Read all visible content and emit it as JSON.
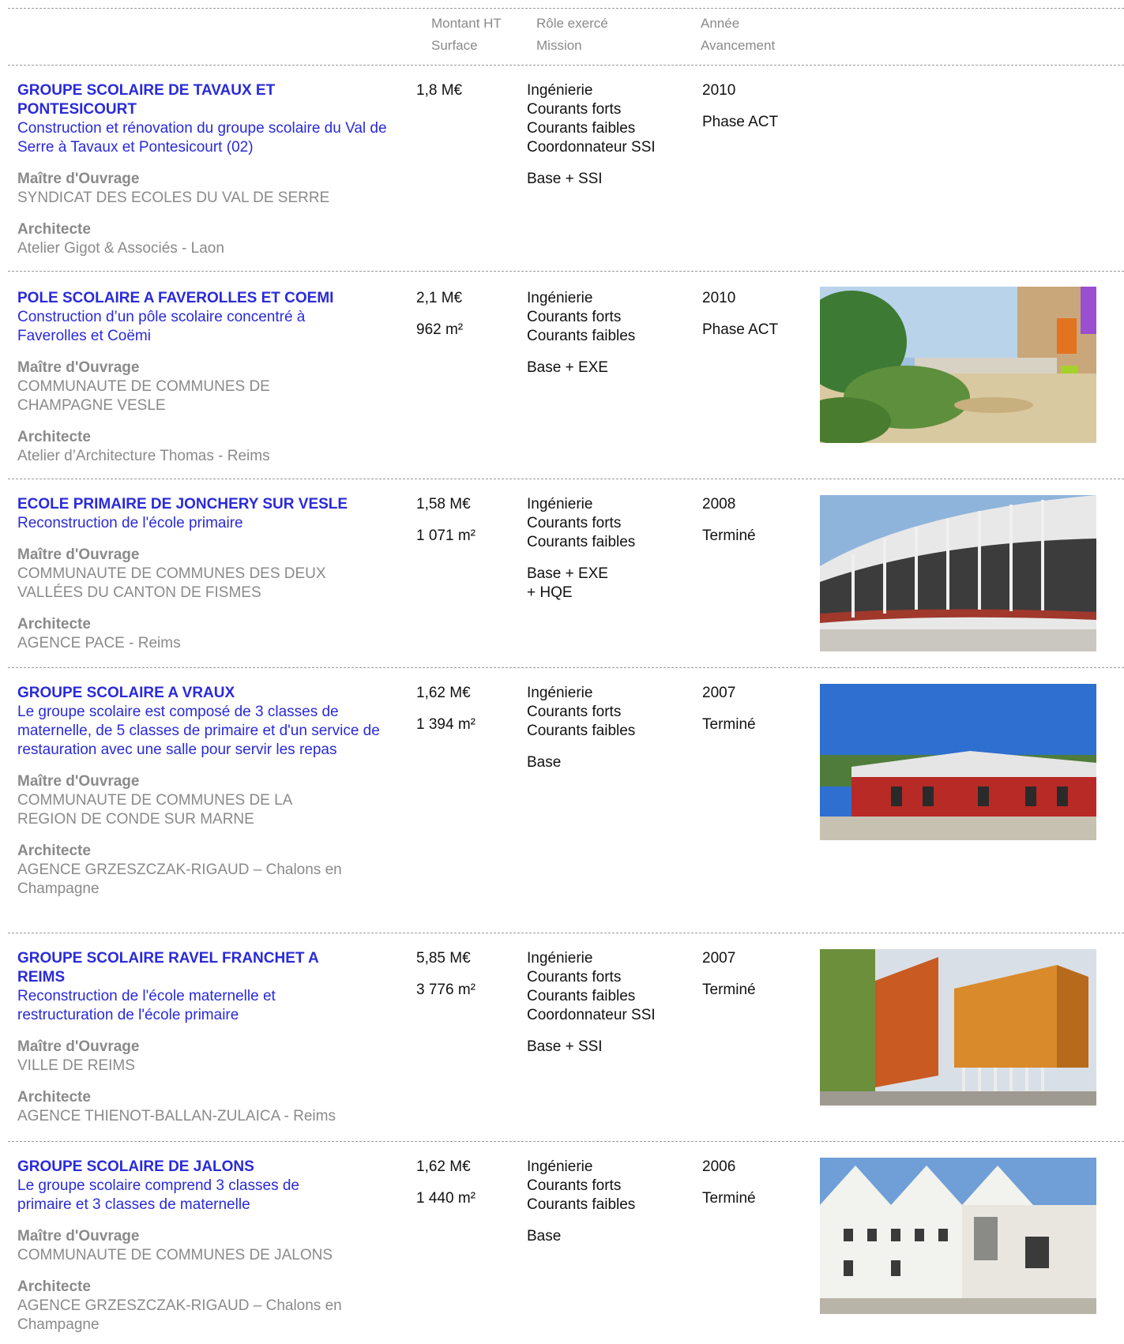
{
  "header": {
    "amount": "Montant HT",
    "surface": "Surface",
    "role": "Rôle exercé",
    "mission": "Mission",
    "year": "Année",
    "progress": "Avancement"
  },
  "labels": {
    "owner": "Maître d'Ouvrage",
    "architect": "Architecte"
  },
  "projects": [
    {
      "title": "GROUPE SCOLAIRE DE TAVAUX ET PONTESICOURT",
      "description": "Construction et rénovation du groupe scolaire du Val de Serre à Tavaux et Pontesicourt (02)",
      "owner": "SYNDICAT DES ECOLES DU VAL DE SERRE",
      "architect": "Atelier Gigot & Associés - Laon",
      "amount": "1,8 M€",
      "surface": "",
      "roles": [
        "Ingénierie",
        "Courants forts",
        "Courants faibles",
        "Coordonnateur SSI"
      ],
      "mission": "Base + SSI",
      "year": "2010",
      "status": "Phase ACT"
    },
    {
      "title": "POLE SCOLAIRE A FAVEROLLES ET COEMI",
      "description": "Construction d’un pôle scolaire concentré à Faverolles et Coëmi",
      "owner": "COMMUNAUTE DE COMMUNES DE CHAMPAGNE VESLE",
      "architect": "Atelier d’Architecture Thomas - Reims",
      "amount": "2,1 M€",
      "surface": "962 m²",
      "roles": [
        "Ingénierie",
        "Courants forts",
        "Courants faibles"
      ],
      "mission": "Base + EXE",
      "year": "2010",
      "status": "Phase ACT"
    },
    {
      "title": "ECOLE PRIMAIRE DE JONCHERY SUR VESLE",
      "description": "Reconstruction de l'école primaire",
      "owner": "COMMUNAUTE DE COMMUNES DES DEUX VALLÉES DU CANTON DE FISMES",
      "architect": "AGENCE PACE - Reims",
      "amount": "1,58 M€",
      "surface": "1 071 m²",
      "roles": [
        "Ingénierie",
        "Courants forts",
        "Courants faibles"
      ],
      "mission": "Base + EXE\n+ HQE",
      "year": "2008",
      "status": "Terminé"
    },
    {
      "title": "GROUPE SCOLAIRE A VRAUX",
      "description": "Le groupe scolaire est composé de 3 classes de maternelle, de 5 classes de primaire et d'un service de restauration avec une salle pour servir les repas",
      "owner": "COMMUNAUTE DE COMMUNES DE LA REGION DE CONDE SUR MARNE",
      "architect": "AGENCE GRZESZCZAK-RIGAUD – Chalons en Champagne",
      "amount": "1,62 M€",
      "surface": "1 394 m²",
      "roles": [
        "Ingénierie",
        "Courants forts",
        "Courants faibles"
      ],
      "mission": "Base",
      "year": "2007",
      "status": "Terminé"
    },
    {
      "title": "GROUPE SCOLAIRE RAVEL FRANCHET A REIMS",
      "description": "Reconstruction de l'école maternelle et restructuration de l'école primaire",
      "owner": "VILLE DE REIMS",
      "architect": "AGENCE THIENOT-BALLAN-ZULAICA - Reims",
      "amount": "5,85 M€",
      "surface": "3 776 m²",
      "roles": [
        "Ingénierie",
        "Courants forts",
        "Courants faibles",
        "Coordonnateur SSI"
      ],
      "mission": "Base + SSI",
      "year": "2007",
      "status": "Terminé"
    },
    {
      "title": "GROUPE SCOLAIRE DE JALONS",
      "description": "Le groupe scolaire comprend 3 classes de primaire et 3 classes de maternelle",
      "owner": "COMMUNAUTE DE COMMUNES DE JALONS",
      "architect": "AGENCE GRZESZCZAK-RIGAUD – Chalons en Champagne",
      "amount": "1,62 M€",
      "surface": "1 440 m²",
      "roles": [
        "Ingénierie",
        "Courants forts",
        "Courants faibles"
      ],
      "mission": "Base",
      "year": "2006",
      "status": "Terminé"
    }
  ]
}
